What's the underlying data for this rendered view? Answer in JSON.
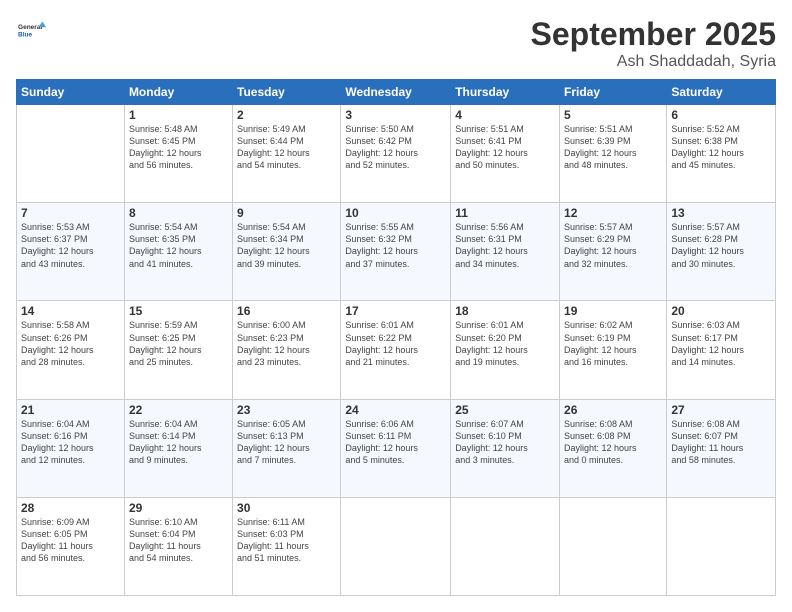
{
  "logo": {
    "general": "General",
    "blue": "Blue"
  },
  "header": {
    "month": "September 2025",
    "location": "Ash Shaddadah, Syria"
  },
  "weekdays": [
    "Sunday",
    "Monday",
    "Tuesday",
    "Wednesday",
    "Thursday",
    "Friday",
    "Saturday"
  ],
  "weeks": [
    [
      {
        "day": "",
        "info": ""
      },
      {
        "day": "1",
        "info": "Sunrise: 5:48 AM\nSunset: 6:45 PM\nDaylight: 12 hours\nand 56 minutes."
      },
      {
        "day": "2",
        "info": "Sunrise: 5:49 AM\nSunset: 6:44 PM\nDaylight: 12 hours\nand 54 minutes."
      },
      {
        "day": "3",
        "info": "Sunrise: 5:50 AM\nSunset: 6:42 PM\nDaylight: 12 hours\nand 52 minutes."
      },
      {
        "day": "4",
        "info": "Sunrise: 5:51 AM\nSunset: 6:41 PM\nDaylight: 12 hours\nand 50 minutes."
      },
      {
        "day": "5",
        "info": "Sunrise: 5:51 AM\nSunset: 6:39 PM\nDaylight: 12 hours\nand 48 minutes."
      },
      {
        "day": "6",
        "info": "Sunrise: 5:52 AM\nSunset: 6:38 PM\nDaylight: 12 hours\nand 45 minutes."
      }
    ],
    [
      {
        "day": "7",
        "info": "Sunrise: 5:53 AM\nSunset: 6:37 PM\nDaylight: 12 hours\nand 43 minutes."
      },
      {
        "day": "8",
        "info": "Sunrise: 5:54 AM\nSunset: 6:35 PM\nDaylight: 12 hours\nand 41 minutes."
      },
      {
        "day": "9",
        "info": "Sunrise: 5:54 AM\nSunset: 6:34 PM\nDaylight: 12 hours\nand 39 minutes."
      },
      {
        "day": "10",
        "info": "Sunrise: 5:55 AM\nSunset: 6:32 PM\nDaylight: 12 hours\nand 37 minutes."
      },
      {
        "day": "11",
        "info": "Sunrise: 5:56 AM\nSunset: 6:31 PM\nDaylight: 12 hours\nand 34 minutes."
      },
      {
        "day": "12",
        "info": "Sunrise: 5:57 AM\nSunset: 6:29 PM\nDaylight: 12 hours\nand 32 minutes."
      },
      {
        "day": "13",
        "info": "Sunrise: 5:57 AM\nSunset: 6:28 PM\nDaylight: 12 hours\nand 30 minutes."
      }
    ],
    [
      {
        "day": "14",
        "info": "Sunrise: 5:58 AM\nSunset: 6:26 PM\nDaylight: 12 hours\nand 28 minutes."
      },
      {
        "day": "15",
        "info": "Sunrise: 5:59 AM\nSunset: 6:25 PM\nDaylight: 12 hours\nand 25 minutes."
      },
      {
        "day": "16",
        "info": "Sunrise: 6:00 AM\nSunset: 6:23 PM\nDaylight: 12 hours\nand 23 minutes."
      },
      {
        "day": "17",
        "info": "Sunrise: 6:01 AM\nSunset: 6:22 PM\nDaylight: 12 hours\nand 21 minutes."
      },
      {
        "day": "18",
        "info": "Sunrise: 6:01 AM\nSunset: 6:20 PM\nDaylight: 12 hours\nand 19 minutes."
      },
      {
        "day": "19",
        "info": "Sunrise: 6:02 AM\nSunset: 6:19 PM\nDaylight: 12 hours\nand 16 minutes."
      },
      {
        "day": "20",
        "info": "Sunrise: 6:03 AM\nSunset: 6:17 PM\nDaylight: 12 hours\nand 14 minutes."
      }
    ],
    [
      {
        "day": "21",
        "info": "Sunrise: 6:04 AM\nSunset: 6:16 PM\nDaylight: 12 hours\nand 12 minutes."
      },
      {
        "day": "22",
        "info": "Sunrise: 6:04 AM\nSunset: 6:14 PM\nDaylight: 12 hours\nand 9 minutes."
      },
      {
        "day": "23",
        "info": "Sunrise: 6:05 AM\nSunset: 6:13 PM\nDaylight: 12 hours\nand 7 minutes."
      },
      {
        "day": "24",
        "info": "Sunrise: 6:06 AM\nSunset: 6:11 PM\nDaylight: 12 hours\nand 5 minutes."
      },
      {
        "day": "25",
        "info": "Sunrise: 6:07 AM\nSunset: 6:10 PM\nDaylight: 12 hours\nand 3 minutes."
      },
      {
        "day": "26",
        "info": "Sunrise: 6:08 AM\nSunset: 6:08 PM\nDaylight: 12 hours\nand 0 minutes."
      },
      {
        "day": "27",
        "info": "Sunrise: 6:08 AM\nSunset: 6:07 PM\nDaylight: 11 hours\nand 58 minutes."
      }
    ],
    [
      {
        "day": "28",
        "info": "Sunrise: 6:09 AM\nSunset: 6:05 PM\nDaylight: 11 hours\nand 56 minutes."
      },
      {
        "day": "29",
        "info": "Sunrise: 6:10 AM\nSunset: 6:04 PM\nDaylight: 11 hours\nand 54 minutes."
      },
      {
        "day": "30",
        "info": "Sunrise: 6:11 AM\nSunset: 6:03 PM\nDaylight: 11 hours\nand 51 minutes."
      },
      {
        "day": "",
        "info": ""
      },
      {
        "day": "",
        "info": ""
      },
      {
        "day": "",
        "info": ""
      },
      {
        "day": "",
        "info": ""
      }
    ]
  ]
}
